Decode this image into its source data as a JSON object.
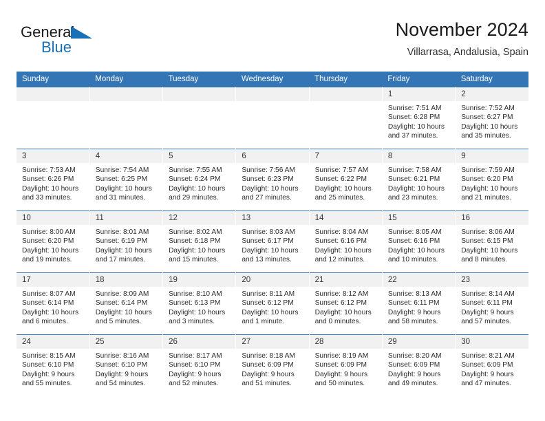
{
  "brand": {
    "name_top": "General",
    "name_bottom": "Blue",
    "triangle_color": "#1a6fb5",
    "top_text_color": "#1a1a1a",
    "bottom_text_color": "#1a6fb5"
  },
  "header": {
    "title": "November 2024",
    "subtitle": "Villarrasa, Andalusia, Spain"
  },
  "theme": {
    "header_blue": "#3375b5",
    "daynum_band": "#f1f1f1",
    "row_rule": "#3375b5",
    "page_background": "#ffffff"
  },
  "weekdays": [
    "Sunday",
    "Monday",
    "Tuesday",
    "Wednesday",
    "Thursday",
    "Friday",
    "Saturday"
  ],
  "weeks": [
    [
      {
        "day": "",
        "empty": true
      },
      {
        "day": "",
        "empty": true
      },
      {
        "day": "",
        "empty": true
      },
      {
        "day": "",
        "empty": true
      },
      {
        "day": "",
        "empty": true
      },
      {
        "day": "1",
        "sunrise": "Sunrise: 7:51 AM",
        "sunset": "Sunset: 6:28 PM",
        "daylight": "Daylight: 10 hours and 37 minutes."
      },
      {
        "day": "2",
        "sunrise": "Sunrise: 7:52 AM",
        "sunset": "Sunset: 6:27 PM",
        "daylight": "Daylight: 10 hours and 35 minutes."
      }
    ],
    [
      {
        "day": "3",
        "sunrise": "Sunrise: 7:53 AM",
        "sunset": "Sunset: 6:26 PM",
        "daylight": "Daylight: 10 hours and 33 minutes."
      },
      {
        "day": "4",
        "sunrise": "Sunrise: 7:54 AM",
        "sunset": "Sunset: 6:25 PM",
        "daylight": "Daylight: 10 hours and 31 minutes."
      },
      {
        "day": "5",
        "sunrise": "Sunrise: 7:55 AM",
        "sunset": "Sunset: 6:24 PM",
        "daylight": "Daylight: 10 hours and 29 minutes."
      },
      {
        "day": "6",
        "sunrise": "Sunrise: 7:56 AM",
        "sunset": "Sunset: 6:23 PM",
        "daylight": "Daylight: 10 hours and 27 minutes."
      },
      {
        "day": "7",
        "sunrise": "Sunrise: 7:57 AM",
        "sunset": "Sunset: 6:22 PM",
        "daylight": "Daylight: 10 hours and 25 minutes."
      },
      {
        "day": "8",
        "sunrise": "Sunrise: 7:58 AM",
        "sunset": "Sunset: 6:21 PM",
        "daylight": "Daylight: 10 hours and 23 minutes."
      },
      {
        "day": "9",
        "sunrise": "Sunrise: 7:59 AM",
        "sunset": "Sunset: 6:20 PM",
        "daylight": "Daylight: 10 hours and 21 minutes."
      }
    ],
    [
      {
        "day": "10",
        "sunrise": "Sunrise: 8:00 AM",
        "sunset": "Sunset: 6:20 PM",
        "daylight": "Daylight: 10 hours and 19 minutes."
      },
      {
        "day": "11",
        "sunrise": "Sunrise: 8:01 AM",
        "sunset": "Sunset: 6:19 PM",
        "daylight": "Daylight: 10 hours and 17 minutes."
      },
      {
        "day": "12",
        "sunrise": "Sunrise: 8:02 AM",
        "sunset": "Sunset: 6:18 PM",
        "daylight": "Daylight: 10 hours and 15 minutes."
      },
      {
        "day": "13",
        "sunrise": "Sunrise: 8:03 AM",
        "sunset": "Sunset: 6:17 PM",
        "daylight": "Daylight: 10 hours and 13 minutes."
      },
      {
        "day": "14",
        "sunrise": "Sunrise: 8:04 AM",
        "sunset": "Sunset: 6:16 PM",
        "daylight": "Daylight: 10 hours and 12 minutes."
      },
      {
        "day": "15",
        "sunrise": "Sunrise: 8:05 AM",
        "sunset": "Sunset: 6:16 PM",
        "daylight": "Daylight: 10 hours and 10 minutes."
      },
      {
        "day": "16",
        "sunrise": "Sunrise: 8:06 AM",
        "sunset": "Sunset: 6:15 PM",
        "daylight": "Daylight: 10 hours and 8 minutes."
      }
    ],
    [
      {
        "day": "17",
        "sunrise": "Sunrise: 8:07 AM",
        "sunset": "Sunset: 6:14 PM",
        "daylight": "Daylight: 10 hours and 6 minutes."
      },
      {
        "day": "18",
        "sunrise": "Sunrise: 8:09 AM",
        "sunset": "Sunset: 6:14 PM",
        "daylight": "Daylight: 10 hours and 5 minutes."
      },
      {
        "day": "19",
        "sunrise": "Sunrise: 8:10 AM",
        "sunset": "Sunset: 6:13 PM",
        "daylight": "Daylight: 10 hours and 3 minutes."
      },
      {
        "day": "20",
        "sunrise": "Sunrise: 8:11 AM",
        "sunset": "Sunset: 6:12 PM",
        "daylight": "Daylight: 10 hours and 1 minute."
      },
      {
        "day": "21",
        "sunrise": "Sunrise: 8:12 AM",
        "sunset": "Sunset: 6:12 PM",
        "daylight": "Daylight: 10 hours and 0 minutes."
      },
      {
        "day": "22",
        "sunrise": "Sunrise: 8:13 AM",
        "sunset": "Sunset: 6:11 PM",
        "daylight": "Daylight: 9 hours and 58 minutes."
      },
      {
        "day": "23",
        "sunrise": "Sunrise: 8:14 AM",
        "sunset": "Sunset: 6:11 PM",
        "daylight": "Daylight: 9 hours and 57 minutes."
      }
    ],
    [
      {
        "day": "24",
        "sunrise": "Sunrise: 8:15 AM",
        "sunset": "Sunset: 6:10 PM",
        "daylight": "Daylight: 9 hours and 55 minutes."
      },
      {
        "day": "25",
        "sunrise": "Sunrise: 8:16 AM",
        "sunset": "Sunset: 6:10 PM",
        "daylight": "Daylight: 9 hours and 54 minutes."
      },
      {
        "day": "26",
        "sunrise": "Sunrise: 8:17 AM",
        "sunset": "Sunset: 6:10 PM",
        "daylight": "Daylight: 9 hours and 52 minutes."
      },
      {
        "day": "27",
        "sunrise": "Sunrise: 8:18 AM",
        "sunset": "Sunset: 6:09 PM",
        "daylight": "Daylight: 9 hours and 51 minutes."
      },
      {
        "day": "28",
        "sunrise": "Sunrise: 8:19 AM",
        "sunset": "Sunset: 6:09 PM",
        "daylight": "Daylight: 9 hours and 50 minutes."
      },
      {
        "day": "29",
        "sunrise": "Sunrise: 8:20 AM",
        "sunset": "Sunset: 6:09 PM",
        "daylight": "Daylight: 9 hours and 49 minutes."
      },
      {
        "day": "30",
        "sunrise": "Sunrise: 8:21 AM",
        "sunset": "Sunset: 6:09 PM",
        "daylight": "Daylight: 9 hours and 47 minutes."
      }
    ]
  ]
}
